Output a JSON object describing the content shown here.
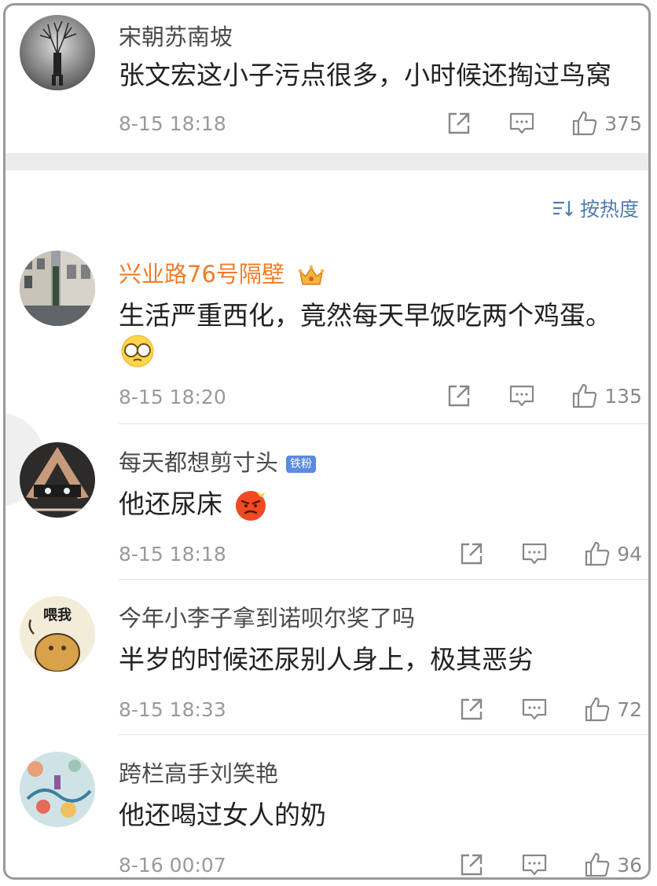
{
  "sort": {
    "label": "按热度"
  },
  "comments": [
    {
      "username": "宋朝苏南坡",
      "text": "张文宏这小子污点很多，小时候还掏过鸟窝",
      "time": "8-15 18:18",
      "likes": "375",
      "avatar_icon": "tree-figure-avatar"
    },
    {
      "username": "兴业路76号隔壁",
      "text": "生活严重西化，竟然每天早饭吃两个鸡蛋。",
      "time": "8-15 18:20",
      "likes": "135",
      "avatar_icon": "street-avatar",
      "user_badge_icon": "crown-icon",
      "emoji": "glasses-emoji"
    },
    {
      "username": "每天都想剪寸头",
      "badge": "铁粉",
      "text": "他还尿床",
      "time": "8-15 18:18",
      "likes": "94",
      "avatar_icon": "hands-face-avatar",
      "emoji": "angry-emoji"
    },
    {
      "username": "今年小李子拿到诺呗尔奖了吗",
      "text": "半岁的时候还尿别人身上，极其恶劣",
      "time": "8-15 18:33",
      "likes": "72",
      "avatar_icon": "cartoon-avatar",
      "avatar_text": "喂我"
    },
    {
      "username": "跨栏高手刘笑艳",
      "text": "他还喝过女人的奶",
      "time": "8-16 00:07",
      "likes": "36",
      "avatar_icon": "painting-avatar"
    }
  ],
  "colors": {
    "vip_name": "#ef7c28",
    "link_blue": "#507daf",
    "badge_blue": "#5b8bde"
  }
}
